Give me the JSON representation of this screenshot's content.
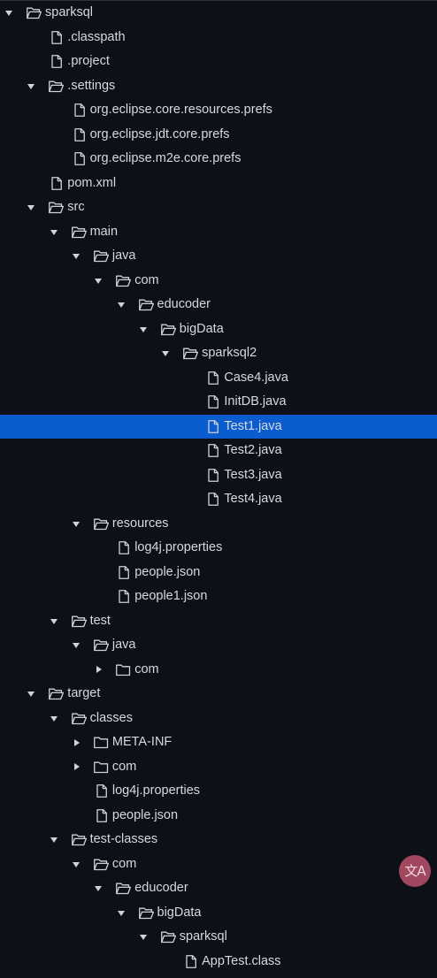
{
  "tree": [
    {
      "label": "sparksql",
      "type": "folder",
      "depth": 0,
      "expanded": true
    },
    {
      "label": ".classpath",
      "type": "file",
      "depth": 1
    },
    {
      "label": ".project",
      "type": "file",
      "depth": 1
    },
    {
      "label": ".settings",
      "type": "folder",
      "depth": 1,
      "expanded": true
    },
    {
      "label": "org.eclipse.core.resources.prefs",
      "type": "file",
      "depth": 2
    },
    {
      "label": "org.eclipse.jdt.core.prefs",
      "type": "file",
      "depth": 2
    },
    {
      "label": "org.eclipse.m2e.core.prefs",
      "type": "file",
      "depth": 2
    },
    {
      "label": "pom.xml",
      "type": "file",
      "depth": 1
    },
    {
      "label": "src",
      "type": "folder",
      "depth": 1,
      "expanded": true
    },
    {
      "label": "main",
      "type": "folder",
      "depth": 2,
      "expanded": true
    },
    {
      "label": "java",
      "type": "folder",
      "depth": 3,
      "expanded": true
    },
    {
      "label": "com",
      "type": "folder",
      "depth": 4,
      "expanded": true
    },
    {
      "label": "educoder",
      "type": "folder",
      "depth": 5,
      "expanded": true
    },
    {
      "label": "bigData",
      "type": "folder",
      "depth": 6,
      "expanded": true
    },
    {
      "label": "sparksql2",
      "type": "folder",
      "depth": 7,
      "expanded": true
    },
    {
      "label": "Case4.java",
      "type": "file",
      "depth": 8
    },
    {
      "label": "InitDB.java",
      "type": "file",
      "depth": 8
    },
    {
      "label": "Test1.java",
      "type": "file",
      "depth": 8,
      "selected": true
    },
    {
      "label": "Test2.java",
      "type": "file",
      "depth": 8
    },
    {
      "label": "Test3.java",
      "type": "file",
      "depth": 8
    },
    {
      "label": "Test4.java",
      "type": "file",
      "depth": 8
    },
    {
      "label": "resources",
      "type": "folder",
      "depth": 3,
      "expanded": true
    },
    {
      "label": "log4j.properties",
      "type": "file",
      "depth": 4
    },
    {
      "label": "people.json",
      "type": "file",
      "depth": 4
    },
    {
      "label": "people1.json",
      "type": "file",
      "depth": 4
    },
    {
      "label": "test",
      "type": "folder",
      "depth": 2,
      "expanded": true
    },
    {
      "label": "java",
      "type": "folder",
      "depth": 3,
      "expanded": true
    },
    {
      "label": "com",
      "type": "folder",
      "depth": 4,
      "expanded": false
    },
    {
      "label": "target",
      "type": "folder",
      "depth": 1,
      "expanded": true
    },
    {
      "label": "classes",
      "type": "folder",
      "depth": 2,
      "expanded": true
    },
    {
      "label": "META-INF",
      "type": "folder",
      "depth": 3,
      "expanded": false
    },
    {
      "label": "com",
      "type": "folder",
      "depth": 3,
      "expanded": false
    },
    {
      "label": "log4j.properties",
      "type": "file",
      "depth": 3
    },
    {
      "label": "people.json",
      "type": "file",
      "depth": 3
    },
    {
      "label": "test-classes",
      "type": "folder",
      "depth": 2,
      "expanded": true
    },
    {
      "label": "com",
      "type": "folder",
      "depth": 3,
      "expanded": true
    },
    {
      "label": "educoder",
      "type": "folder",
      "depth": 4,
      "expanded": true
    },
    {
      "label": "bigData",
      "type": "folder",
      "depth": 5,
      "expanded": true
    },
    {
      "label": "sparksql",
      "type": "folder",
      "depth": 6,
      "expanded": true
    },
    {
      "label": "AppTest.class",
      "type": "file",
      "depth": 7
    }
  ],
  "badge": {
    "icon": "translate-icon",
    "text": "文A"
  },
  "colors": {
    "background": "#0d1117",
    "selection": "#0b5ccf",
    "text": "#d6d9de",
    "icon": "#cfd3d8",
    "badge": "#a24760"
  }
}
